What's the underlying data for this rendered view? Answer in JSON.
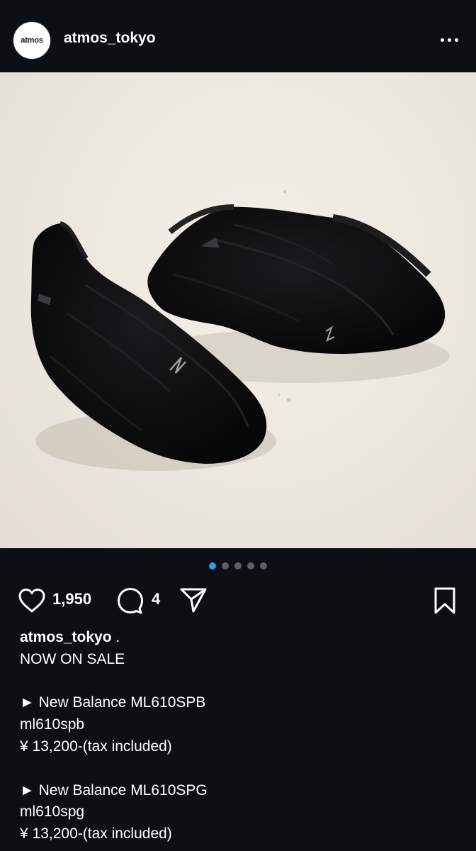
{
  "post": {
    "username": "atmos_tokyo",
    "avatar_text": "atmos",
    "carousel": {
      "count": 5,
      "active_index": 0
    },
    "likes": "1,950",
    "comments": "4"
  },
  "caption": {
    "username": "atmos_tokyo",
    "username_suffix": " .",
    "lines": [
      "NOW ON SALE",
      "",
      "► New Balance ML610SPB",
      "ml610spb",
      "¥ 13,200-(tax included)",
      "",
      "► New Balance ML610SPG",
      "ml610spg",
      "¥ 13,200-(tax included)"
    ]
  },
  "icons": {
    "more": "more-options-icon",
    "like": "heart-icon",
    "comment": "comment-icon",
    "share": "share-icon",
    "save": "bookmark-icon"
  },
  "colors": {
    "background": "#0c0f14",
    "active_dot": "#2f9bf3",
    "inactive_dot": "#5b5f66"
  }
}
